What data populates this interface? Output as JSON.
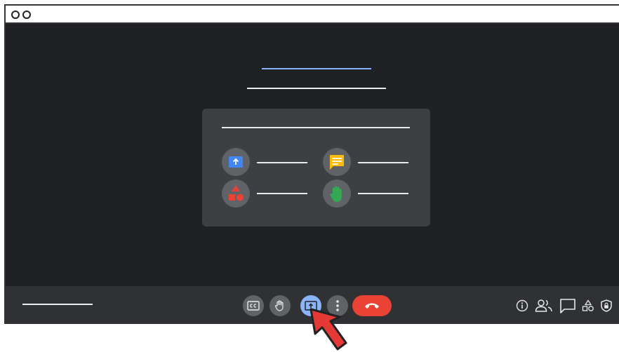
{
  "window": {
    "controls": [
      "window-dot",
      "window-dot"
    ]
  },
  "dialog": {
    "features": [
      {
        "icon": "present-screen-icon",
        "color": "#4285f4"
      },
      {
        "icon": "chat-icon",
        "color": "#fbbc04"
      },
      {
        "icon": "activities-icon",
        "color": "#ea4335"
      },
      {
        "icon": "raise-hand-icon",
        "color": "#34a853"
      }
    ]
  },
  "toolbar": {
    "buttons": [
      {
        "name": "captions-button",
        "icon": "cc-icon",
        "glyph": "CC"
      },
      {
        "name": "raise-hand-button",
        "icon": "hand-icon"
      },
      {
        "name": "present-now-button",
        "icon": "present-screen-icon",
        "active": true
      },
      {
        "name": "more-options-button",
        "icon": "more-vert-icon"
      },
      {
        "name": "leave-call-button",
        "icon": "call-end-icon"
      }
    ],
    "right": [
      "info-icon",
      "people-icon",
      "chat-icon",
      "activities-icon",
      "host-controls-icon"
    ]
  },
  "colors": {
    "background": "#202124",
    "card": "#3c4043",
    "toolbar": "#303134",
    "accent_blue": "#8ab4f8",
    "end_call_red": "#ea4335",
    "pointer_red": "#e53935"
  }
}
